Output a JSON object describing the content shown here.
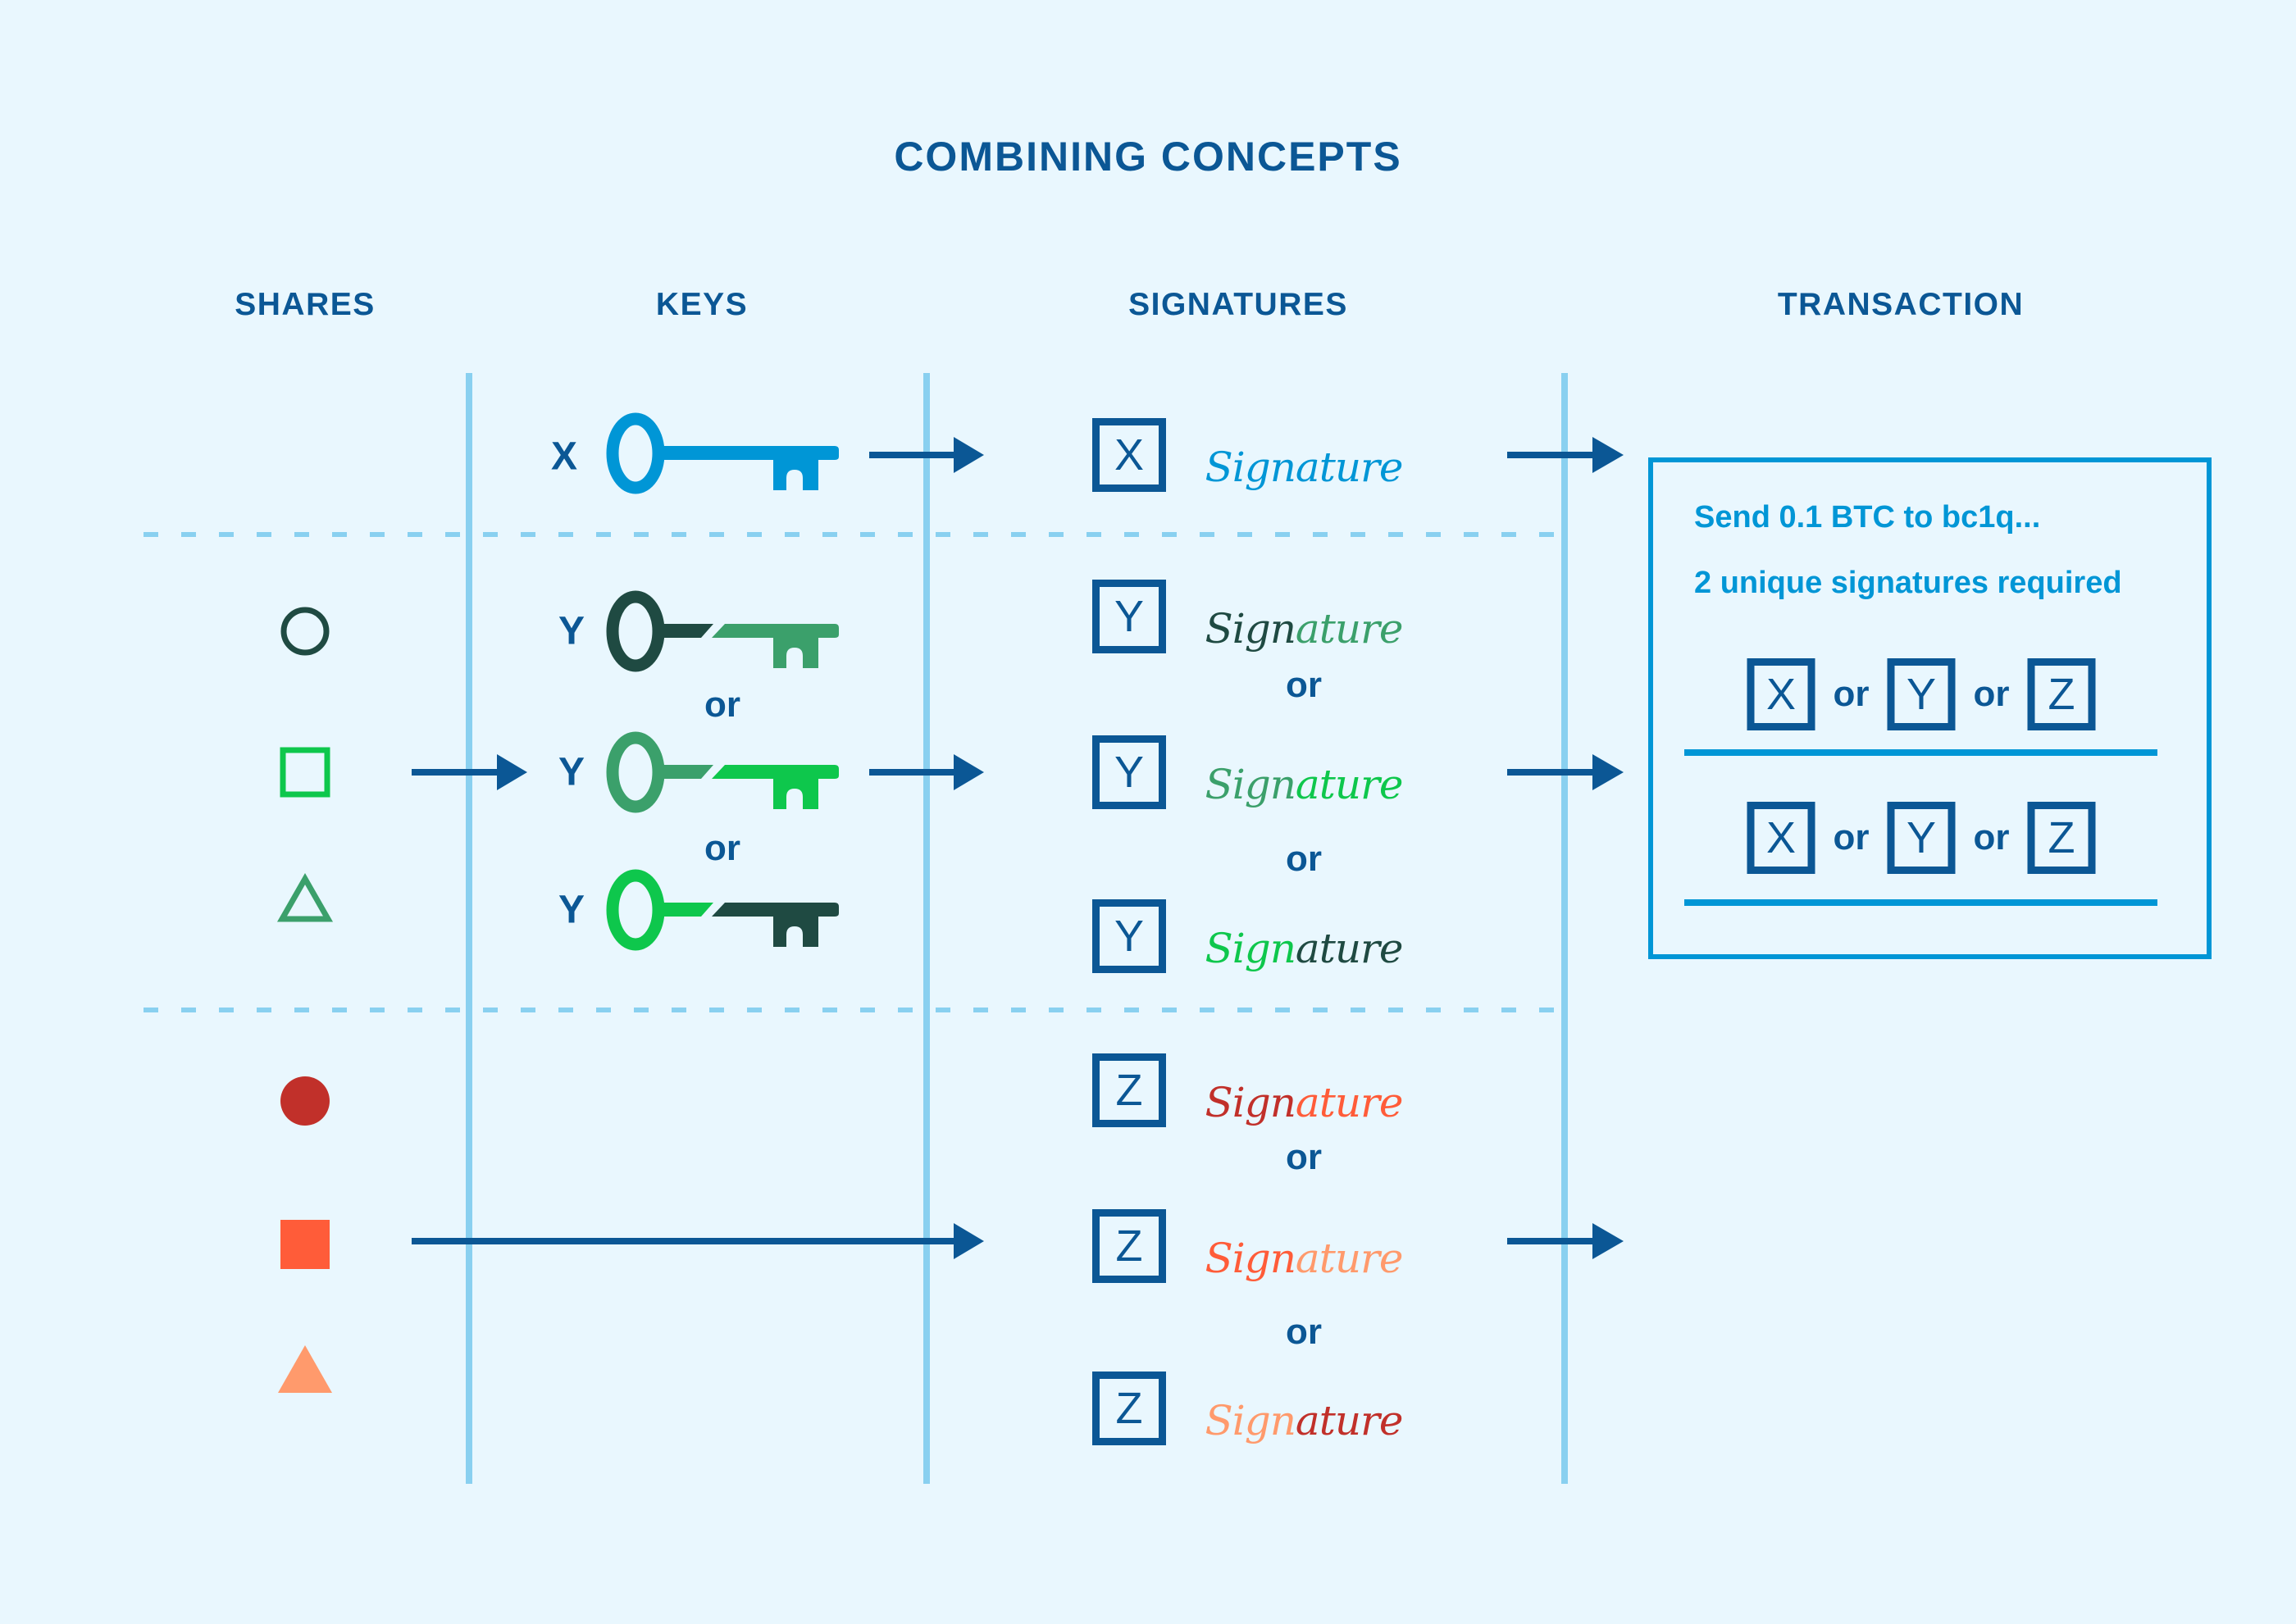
{
  "title": "COMBINING CONCEPTS",
  "columns": {
    "shares": "SHARES",
    "keys": "KEYS",
    "signatures": "SIGNATURES",
    "transaction": "TRANSACTION"
  },
  "colors": {
    "background": "#e9f7fe",
    "text_primary": "#0b5795",
    "accent_blue": "#0096d6",
    "divider": "#89d0f0",
    "green_dark": "#1f4a42",
    "green_mid": "#3ba06b",
    "green_bright": "#0ec74c",
    "red_dark": "#c1302a",
    "red_mid": "#ff5c39",
    "red_light": "#ff9a6c"
  },
  "keys": {
    "x": {
      "label": "X",
      "icon": "key-icon",
      "bow_color": "#0096d6",
      "bit_color": "#0096d6"
    },
    "y": [
      {
        "label": "Y",
        "icon": "key-icon",
        "bow_color": "#1f4a42",
        "bit_color": "#3ba06b"
      },
      {
        "label": "Y",
        "icon": "key-icon",
        "bow_color": "#3ba06b",
        "bit_color": "#0ec74c"
      },
      {
        "label": "Y",
        "icon": "key-icon",
        "bow_color": "#0ec74c",
        "bit_color": "#1f4a42"
      }
    ],
    "or_label": "or"
  },
  "shares": {
    "y": [
      {
        "shape": "circle-outline",
        "color": "#1f4a42"
      },
      {
        "shape": "square-outline",
        "color": "#0ec74c"
      },
      {
        "shape": "triangle-outline",
        "color": "#3ba06b"
      }
    ],
    "z": [
      {
        "shape": "circle-filled",
        "color": "#c1302a"
      },
      {
        "shape": "square-filled",
        "color": "#ff5c39"
      },
      {
        "shape": "triangle-filled",
        "color": "#ff9a6c"
      }
    ]
  },
  "signatures": {
    "word_start": "Sign",
    "word_end": "ature",
    "or_label": "or",
    "x": [
      {
        "letter": "X",
        "start_color": "#0096d6",
        "end_color": "#0096d6"
      }
    ],
    "y": [
      {
        "letter": "Y",
        "start_color": "#1f4a42",
        "end_color": "#3ba06b"
      },
      {
        "letter": "Y",
        "start_color": "#3ba06b",
        "end_color": "#0ec74c"
      },
      {
        "letter": "Y",
        "start_color": "#0ec74c",
        "end_color": "#1f4a42"
      }
    ],
    "z": [
      {
        "letter": "Z",
        "start_color": "#c1302a",
        "end_color": "#ff5c39"
      },
      {
        "letter": "Z",
        "start_color": "#ff5c39",
        "end_color": "#ff9a6c"
      },
      {
        "letter": "Z",
        "start_color": "#ff9a6c",
        "end_color": "#c1302a"
      }
    ]
  },
  "transaction": {
    "line1": "Send 0.1 BTC to bc1q...",
    "line2": "2 unique signatures required",
    "slots": [
      {
        "options": [
          "X",
          "Y",
          "Z"
        ],
        "or_label": "or"
      },
      {
        "options": [
          "X",
          "Y",
          "Z"
        ],
        "or_label": "or"
      }
    ]
  }
}
